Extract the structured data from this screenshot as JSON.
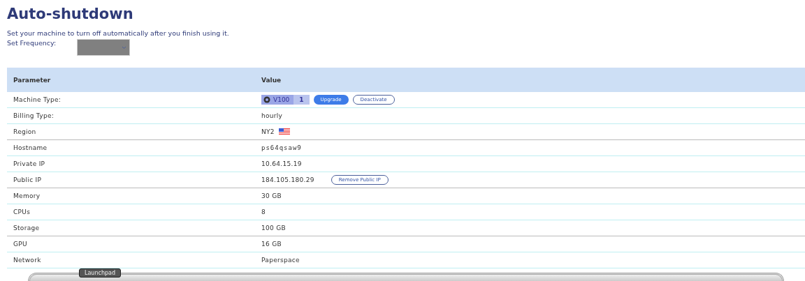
{
  "title": "Auto-shutdown",
  "description": "Set your machine to turn off automatically after you finish using it.",
  "frequency": {
    "label": "Set Frequency:"
  },
  "table": {
    "columns": [
      "Parameter",
      "Value"
    ],
    "rows": [
      {
        "kind": "machine",
        "parameter": "Machine Type:",
        "chip": {
          "label": "V100",
          "count": "1"
        },
        "buttons": [
          {
            "label": "Upgrade",
            "kind": "filled"
          },
          {
            "label": "Deactivate",
            "kind": "outline"
          }
        ]
      },
      {
        "kind": "text",
        "parameter": "Billing Type:",
        "value": "hourly"
      },
      {
        "kind": "flag",
        "parameter": "Region",
        "value": "NY2"
      },
      {
        "kind": "mono",
        "parameter": "Hostname",
        "value": "ps64qsaw9"
      },
      {
        "kind": "text",
        "parameter": "Private IP",
        "value": "10.64.15.19"
      },
      {
        "kind": "text",
        "parameter": "Public IP",
        "value": "184.105.180.29",
        "buttons": [
          {
            "label": "Remove Public IP",
            "kind": "outline"
          }
        ]
      },
      {
        "kind": "text",
        "parameter": "Memory",
        "value": "30 GB"
      },
      {
        "kind": "text",
        "parameter": "CPUs",
        "value": "8"
      },
      {
        "kind": "text",
        "parameter": "Storage",
        "value": "100 GB"
      },
      {
        "kind": "text",
        "parameter": "GPU",
        "value": "16 GB"
      },
      {
        "kind": "text",
        "parameter": "Network",
        "value": "Paperspace"
      }
    ]
  },
  "dock": {
    "tooltip": "Launchpad"
  }
}
